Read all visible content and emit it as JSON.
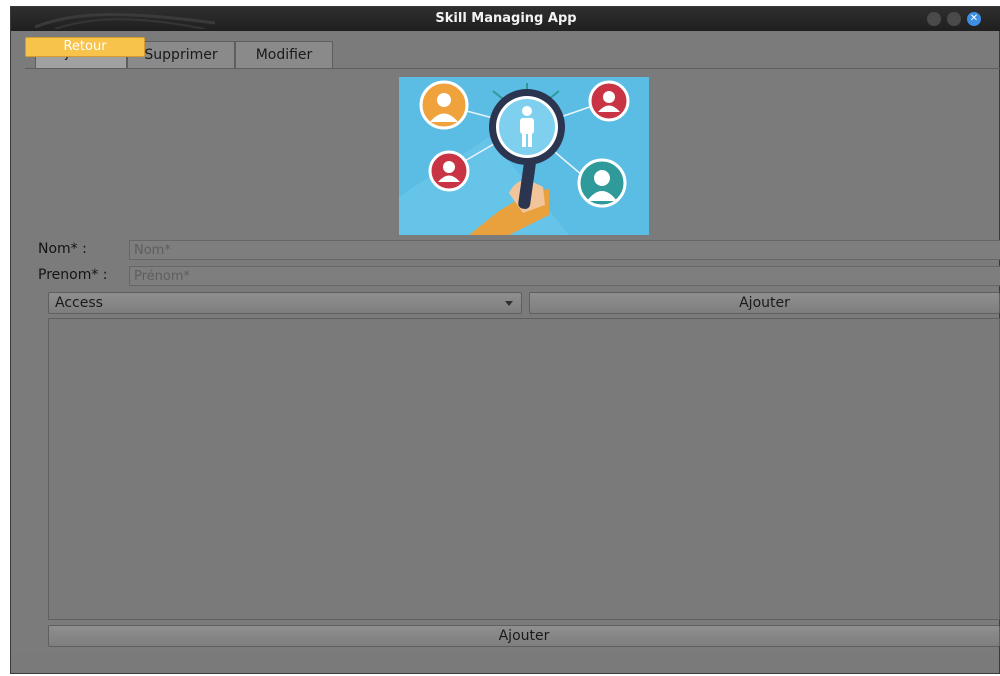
{
  "window": {
    "title": "Skill Managing App",
    "close_glyph": "✕"
  },
  "retour_button": "Retour",
  "tabs": [
    {
      "label": "Ajouter",
      "active": true
    },
    {
      "label": "Supprimer",
      "active": false
    },
    {
      "label": "Modifier",
      "active": false
    }
  ],
  "form": {
    "nom_label": "Nom* :",
    "nom_placeholder": "Nom*",
    "prenom_label": "Prenom* :",
    "prenom_placeholder": "Prénom*",
    "skill_selected": "Access",
    "add_skill_button": "Ajouter",
    "submit_button": "Ajouter"
  },
  "illustration": {
    "icon": "people-search-illustration",
    "colors": {
      "background": "#5bbde4",
      "orange": "#f0a23c",
      "red": "#c93444",
      "teal": "#2e9a9a",
      "handle": "#2b3550",
      "sleeve": "#e8a13c"
    }
  },
  "colors": {
    "window_bg": "#7b7b7b",
    "titlebar": "#262626",
    "retour_bg": "#f7c34b",
    "close_accent": "#3d8ee0"
  }
}
